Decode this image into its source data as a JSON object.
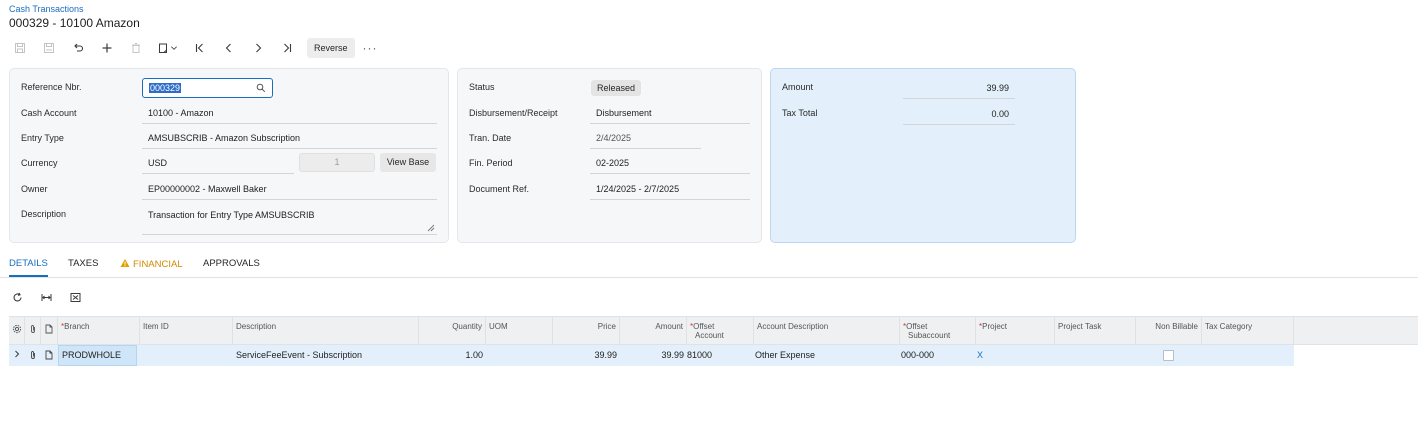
{
  "breadcrumb": "Cash Transactions",
  "title": "000329 - 10100 Amazon",
  "toolbar": {
    "icons": [
      "save-icon",
      "save-close-icon",
      "undo-icon",
      "add-icon",
      "delete-icon",
      "copy-paste-icon",
      "first-icon",
      "prev-icon",
      "next-icon",
      "last-icon"
    ],
    "reverse_label": "Reverse",
    "more_label": "···"
  },
  "summary": {
    "reference_nbr_label": "Reference Nbr.",
    "reference_nbr": "000329",
    "cash_account_label": "Cash Account",
    "cash_account": "10100 - Amazon",
    "entry_type_label": "Entry Type",
    "entry_type": "AMSUBSCRIB - Amazon Subscription",
    "currency_label": "Currency",
    "currency": "USD",
    "rate": "1",
    "view_base_label": "View Base",
    "owner_label": "Owner",
    "owner": "EP00000002 - Maxwell Baker",
    "description_label": "Description",
    "description": "Transaction for Entry Type AMSUBSCRIB"
  },
  "status_panel": {
    "status_label": "Status",
    "status": "Released",
    "disb_receipt_label": "Disbursement/Receipt",
    "disb_receipt": "Disbursement",
    "tran_date_label": "Tran. Date",
    "tran_date": "2/4/2025",
    "fin_period_label": "Fin. Period",
    "fin_period": "02-2025",
    "document_ref_label": "Document Ref.",
    "document_ref": "1/24/2025 - 2/7/2025"
  },
  "totals": {
    "amount_label": "Amount",
    "amount": "39.99",
    "tax_total_label": "Tax Total",
    "tax_total": "0.00"
  },
  "tabs": [
    {
      "label": "DETAILS",
      "active": true
    },
    {
      "label": "TAXES"
    },
    {
      "label": "FINANCIAL",
      "warning": true
    },
    {
      "label": "APPROVALS"
    }
  ],
  "grid": {
    "columns": {
      "branch": "Branch",
      "item_id": "Item ID",
      "description": "Description",
      "quantity": "Quantity",
      "uom": "UOM",
      "price": "Price",
      "amount": "Amount",
      "offset_account_1": "Offset",
      "offset_account_2": "Account",
      "account_description": "Account Description",
      "offset_subaccount_1": "Offset",
      "offset_subaccount_2": "Subaccount",
      "project": "Project",
      "project_task": "Project Task",
      "non_billable": "Non Billable",
      "tax_category": "Tax Category"
    },
    "rows": [
      {
        "branch": "PRODWHOLE",
        "item_id": "",
        "description": "ServiceFeeEvent - Subscription",
        "quantity": "1.00",
        "uom": "",
        "price": "39.99",
        "amount": "39.99",
        "offset_account": "81000",
        "account_description": "Other Expense",
        "offset_subaccount": "000-000",
        "project": "X",
        "project_task": "",
        "non_billable": false,
        "tax_category": ""
      }
    ]
  },
  "colors": {
    "accent": "#1a6ec1",
    "warning": "#d08a00",
    "required": "#d9302c",
    "totals_panel_bg": "#e3f0fb"
  }
}
